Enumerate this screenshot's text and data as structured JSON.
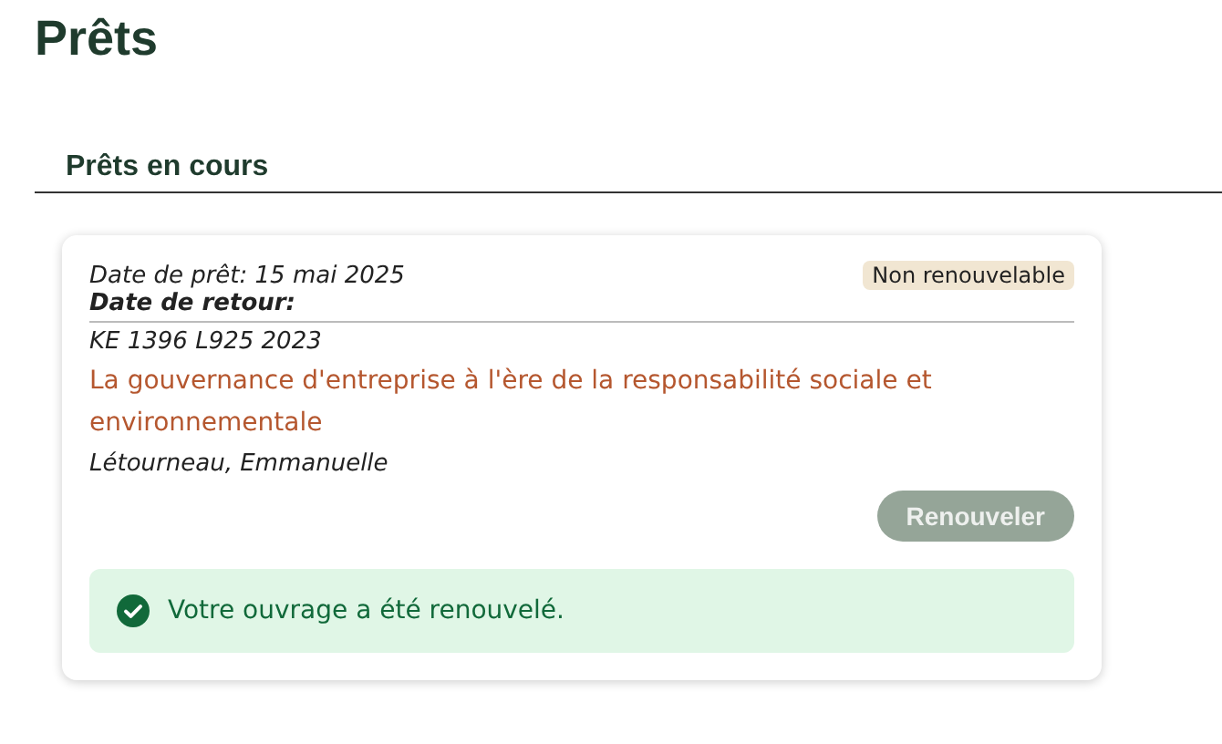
{
  "page_title": "Prêts",
  "section": {
    "heading": "Prêts en cours"
  },
  "loans": [
    {
      "loan_date": "Date de prêt: 15 mai 2025",
      "return_label": "Date de retour:",
      "badge": "Non renouvelable",
      "call_number": "KE 1396 L925 2023",
      "title": "La gouvernance d'entreprise à l'ère de la responsabilité sociale et environnementale",
      "author": "Létourneau, Emmanuelle",
      "button": {
        "label": "Renouveler",
        "disabled": true
      },
      "alert": {
        "kind": "success",
        "message": "Votre ouvrage a été renouvelé."
      }
    }
  ]
}
